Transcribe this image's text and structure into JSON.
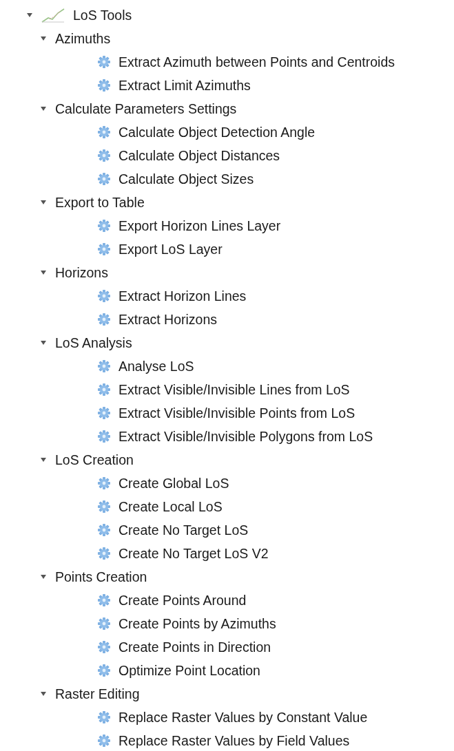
{
  "tree": [
    {
      "label": "LoS Tools",
      "kind": "provider",
      "expanded": true,
      "children": [
        {
          "label": "Azimuths",
          "kind": "group",
          "expanded": true,
          "children": [
            {
              "label": "Extract Azimuth between Points and Centroids",
              "kind": "tool"
            },
            {
              "label": "Extract Limit Azimuths",
              "kind": "tool"
            }
          ]
        },
        {
          "label": "Calculate Parameters Settings",
          "kind": "group",
          "expanded": true,
          "children": [
            {
              "label": "Calculate Object Detection Angle",
              "kind": "tool"
            },
            {
              "label": "Calculate Object Distances",
              "kind": "tool"
            },
            {
              "label": "Calculate Object Sizes",
              "kind": "tool"
            }
          ]
        },
        {
          "label": "Export to Table",
          "kind": "group",
          "expanded": true,
          "children": [
            {
              "label": "Export Horizon Lines Layer",
              "kind": "tool"
            },
            {
              "label": "Export LoS Layer",
              "kind": "tool"
            }
          ]
        },
        {
          "label": "Horizons",
          "kind": "group",
          "expanded": true,
          "children": [
            {
              "label": "Extract Horizon Lines",
              "kind": "tool"
            },
            {
              "label": "Extract Horizons",
              "kind": "tool"
            }
          ]
        },
        {
          "label": "LoS Analysis",
          "kind": "group",
          "expanded": true,
          "children": [
            {
              "label": "Analyse LoS",
              "kind": "tool"
            },
            {
              "label": "Extract Visible/Invisible Lines from LoS",
              "kind": "tool"
            },
            {
              "label": "Extract Visible/Invisible Points from LoS",
              "kind": "tool"
            },
            {
              "label": "Extract Visible/Invisible Polygons from LoS",
              "kind": "tool"
            }
          ]
        },
        {
          "label": "LoS Creation",
          "kind": "group",
          "expanded": true,
          "children": [
            {
              "label": "Create Global LoS",
              "kind": "tool"
            },
            {
              "label": "Create Local LoS",
              "kind": "tool"
            },
            {
              "label": "Create No Target LoS",
              "kind": "tool"
            },
            {
              "label": "Create No Target LoS V2",
              "kind": "tool"
            }
          ]
        },
        {
          "label": "Points Creation",
          "kind": "group",
          "expanded": true,
          "children": [
            {
              "label": "Create Points Around",
              "kind": "tool"
            },
            {
              "label": "Create Points by Azimuths",
              "kind": "tool"
            },
            {
              "label": "Create Points in Direction",
              "kind": "tool"
            },
            {
              "label": "Optimize Point Location",
              "kind": "tool"
            }
          ]
        },
        {
          "label": "Raster Editing",
          "kind": "group",
          "expanded": true,
          "children": [
            {
              "label": "Replace Raster Values by Constant Value",
              "kind": "tool"
            },
            {
              "label": "Replace Raster Values by Field Values",
              "kind": "tool"
            }
          ]
        }
      ]
    }
  ]
}
